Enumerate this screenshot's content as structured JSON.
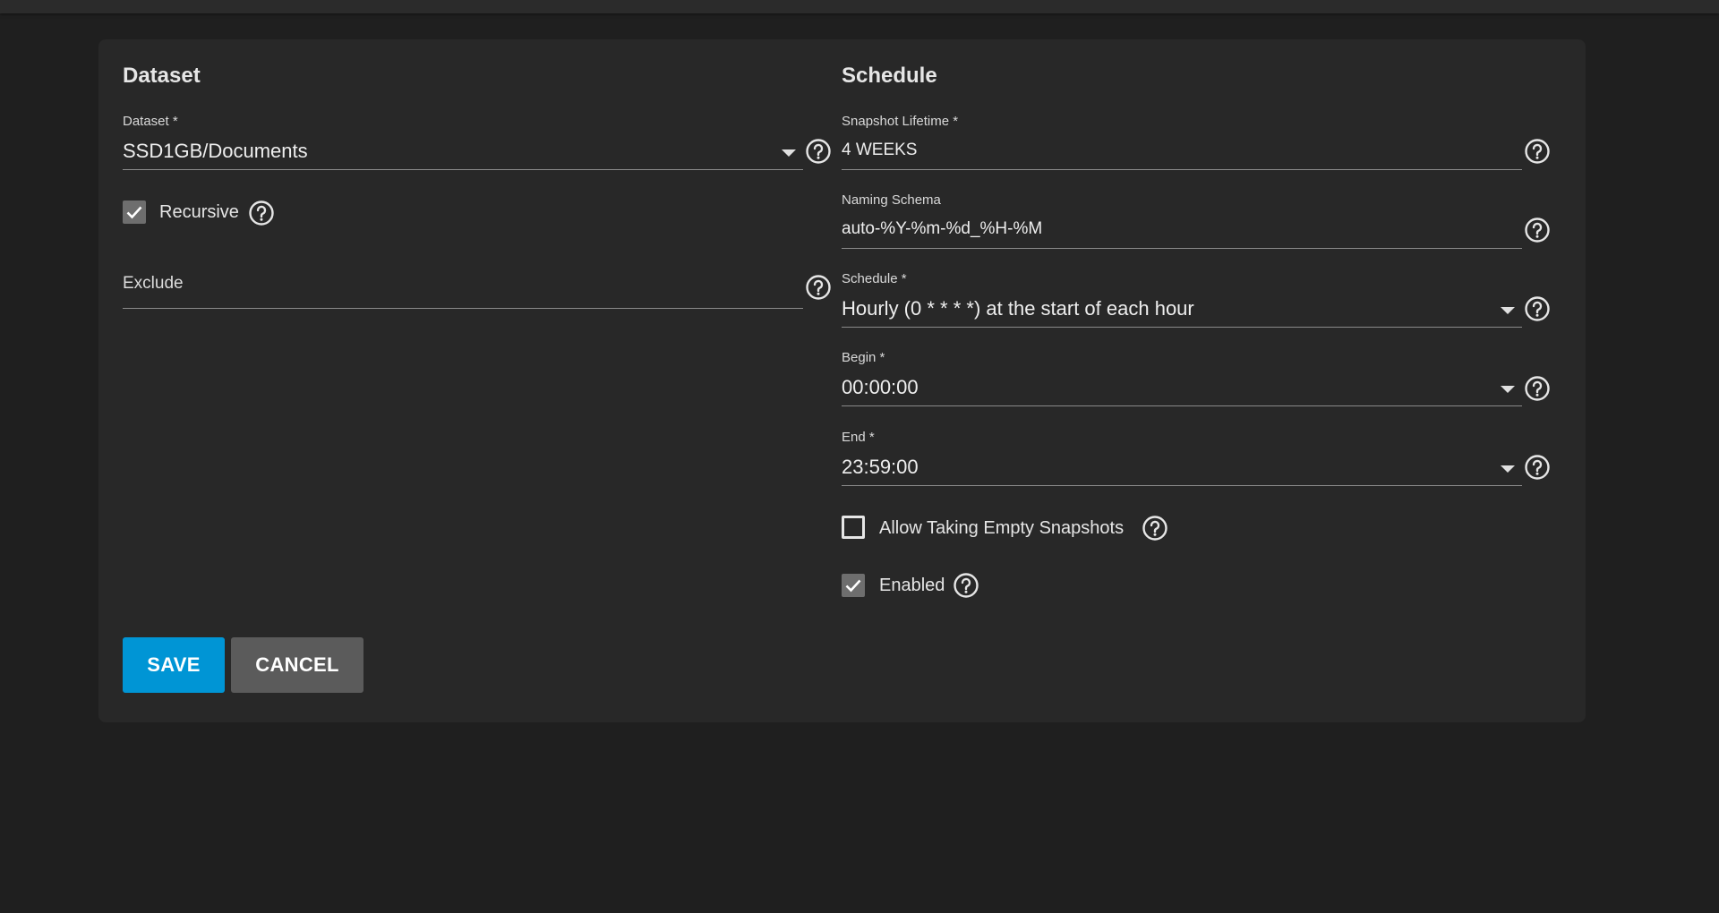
{
  "dataset_section": {
    "title": "Dataset",
    "dataset_field": {
      "label": "Dataset *",
      "value": "SSD1GB/Documents"
    },
    "recursive": {
      "label": "Recursive",
      "checked": true
    },
    "exclude_field": {
      "placeholder": "Exclude"
    }
  },
  "schedule_section": {
    "title": "Schedule",
    "snapshot_lifetime": {
      "label": "Snapshot Lifetime *",
      "value": "4 WEEKS"
    },
    "naming_schema": {
      "label": "Naming Schema",
      "value": "auto-%Y-%m-%d_%H-%M"
    },
    "schedule": {
      "label": "Schedule *",
      "value": "Hourly (0 * * * *) at the start of each hour"
    },
    "begin": {
      "label": "Begin *",
      "value": "00:00:00"
    },
    "end": {
      "label": "End *",
      "value": "23:59:00"
    },
    "allow_empty": {
      "label": "Allow Taking Empty Snapshots",
      "checked": false
    },
    "enabled": {
      "label": "Enabled",
      "checked": true
    }
  },
  "actions": {
    "save_label": "SAVE",
    "cancel_label": "CANCEL"
  },
  "colors": {
    "background": "#1f1f1f",
    "card": "#282828",
    "primary": "#0095d5",
    "cancel": "#5b5b5b",
    "checkbox_checked": "#6e6e6e"
  },
  "icons": {
    "help": "help-circle-icon",
    "dropdown": "caret-down-icon",
    "check": "check-icon"
  }
}
